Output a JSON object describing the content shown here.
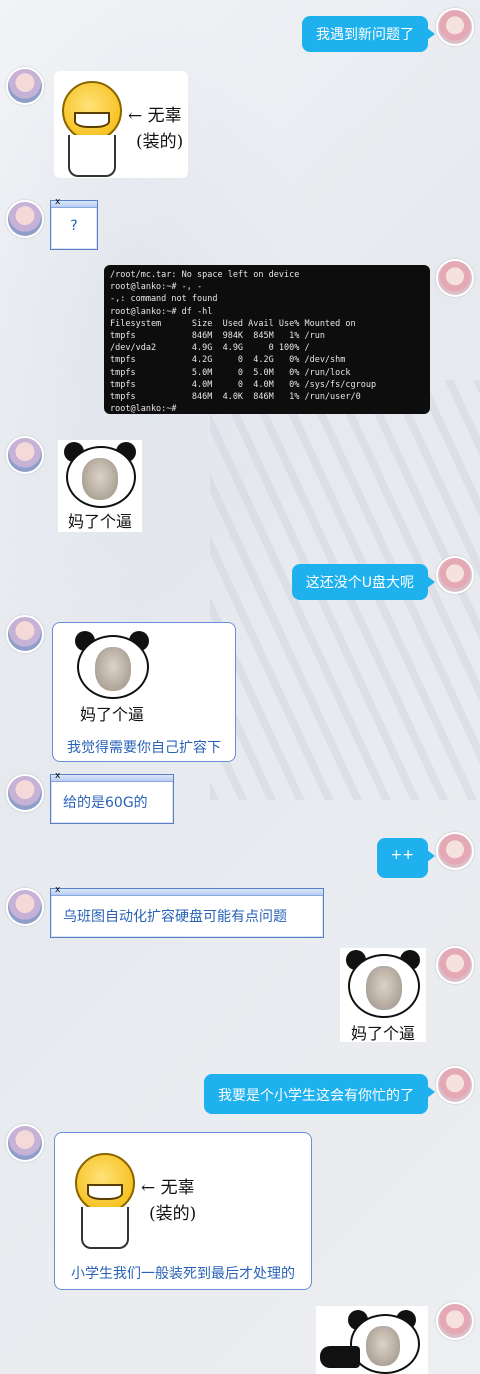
{
  "messages": {
    "m1": "我遇到新问题了",
    "m2": "?",
    "m3_terminal": [
      "/root/mc.tar: No space left on device",
      "root@lanko:~# -, -",
      "-,: command not found",
      "root@lanko:~# df -hl",
      "Filesystem      Size  Used Avail Use% Mounted on",
      "tmpfs           846M  984K  845M   1% /run",
      "/dev/vda2       4.9G  4.9G     0 100% /",
      "tmpfs           4.2G     0  4.2G   0% /dev/shm",
      "tmpfs           5.0M     0  5.0M   0% /run/lock",
      "tmpfs           4.0M     0  4.0M   0% /sys/fs/cgroup",
      "tmpfs           846M  4.0K  846M   1% /run/user/0",
      "root@lanko:~#"
    ],
    "m4_meme": "妈了个逼",
    "m5": "这还没个U盘大呢",
    "m6_meme": "妈了个逼",
    "m6_text": "我觉得需要你自己扩容下",
    "m7": "给的是60G的",
    "m8": "++",
    "m9": "乌班图自动化扩容硬盘可能有点问题",
    "m10_meme": "妈了个逼",
    "m11": "我要是个小学生这会有你忙的了",
    "m12_text": "小学生我们一般装死到最后才处理的",
    "sticker_text_1": "← 无辜",
    "sticker_text_2": "(装的)"
  },
  "colors": {
    "blue_bubble": "#1fb1ee",
    "link_text": "#2a62b8"
  }
}
